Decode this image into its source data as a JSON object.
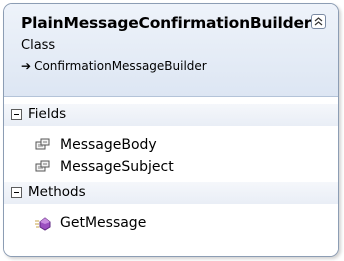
{
  "class": {
    "name": "PlainMessageConfirmationBuilder",
    "stereotype": "Class",
    "base_arrow": "➔",
    "base_class": "ConfirmationMessageBuilder"
  },
  "sections": {
    "fields": {
      "label": "Fields",
      "items": [
        {
          "label": "MessageBody",
          "icon": "property-icon"
        },
        {
          "label": "MessageSubject",
          "icon": "property-icon"
        }
      ]
    },
    "methods": {
      "label": "Methods",
      "items": [
        {
          "label": "GetMessage",
          "icon": "method-icon"
        }
      ]
    }
  },
  "colors": {
    "border": "#8c9db4",
    "header_gradient_top": "#eef3fa",
    "header_gradient_bottom": "#dde6f3",
    "method_icon": "#8b3fa8"
  }
}
